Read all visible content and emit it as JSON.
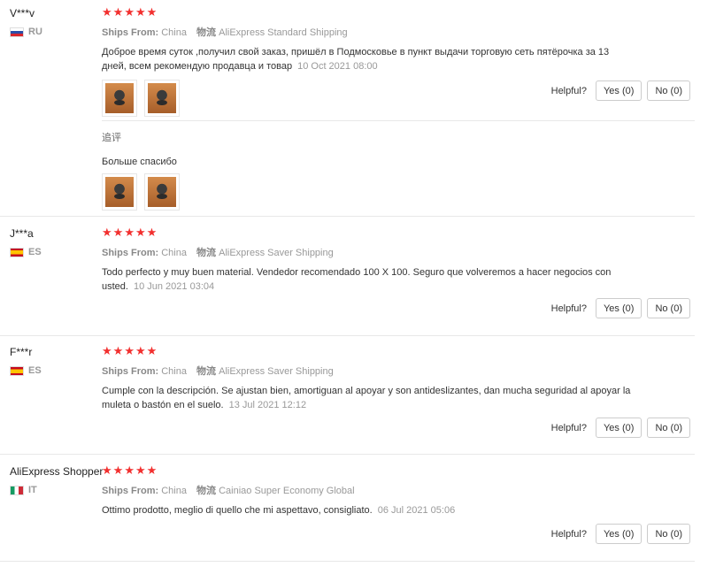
{
  "reviews": [
    {
      "buyer": "V***v",
      "country": "RU",
      "rating": 5,
      "ships_from_label": "Ships From:",
      "ships_from": "China",
      "logistics_label": "物流",
      "logistics": "AliExpress Standard Shipping",
      "text": "Доброе время суток ,получил свой заказ, пришёл в Подмосковье в пункт выдачи торговую сеть пятёрочка за 13 дней, всем рекомендую продавца и товар",
      "date": "10 Oct 2021 08:00",
      "photos": 2,
      "helpful_label": "Helpful?",
      "yes": "Yes (0)",
      "no": "No (0)",
      "append": {
        "label": "追评",
        "text": "Больше спасибо",
        "photos": 2
      }
    },
    {
      "buyer": "J***a",
      "country": "ES",
      "rating": 5,
      "ships_from_label": "Ships From:",
      "ships_from": "China",
      "logistics_label": "物流",
      "logistics": "AliExpress Saver Shipping",
      "text": "Todo perfecto y muy buen material. Vendedor recomendado 100 X 100. Seguro que volveremos a hacer negocios con usted.",
      "date": "10 Jun 2021 03:04",
      "helpful_label": "Helpful?",
      "yes": "Yes (0)",
      "no": "No (0)"
    },
    {
      "buyer": "F***r",
      "country": "ES",
      "rating": 5,
      "ships_from_label": "Ships From:",
      "ships_from": "China",
      "logistics_label": "物流",
      "logistics": "AliExpress Saver Shipping",
      "text": "Cumple con la descripción. Se ajustan bien, amortiguan al apoyar y son antideslizantes, dan mucha seguridad al apoyar la muleta o bastón en el suelo.",
      "date": "13 Jul 2021 12:12",
      "helpful_label": "Helpful?",
      "yes": "Yes (0)",
      "no": "No (0)"
    },
    {
      "buyer": "AliExpress Shopper",
      "country": "IT",
      "rating": 5,
      "ships_from_label": "Ships From:",
      "ships_from": "China",
      "logistics_label": "物流",
      "logistics": "Cainiao Super Economy Global",
      "text": "Ottimo prodotto, meglio di quello che mi aspettavo, consigliato.",
      "date": "06 Jul 2021 05:06",
      "helpful_label": "Helpful?",
      "yes": "Yes (0)",
      "no": "No (0)"
    }
  ],
  "colors": {
    "star": "#f2302f",
    "muted": "#999999",
    "divider": "#e8e8e8"
  }
}
